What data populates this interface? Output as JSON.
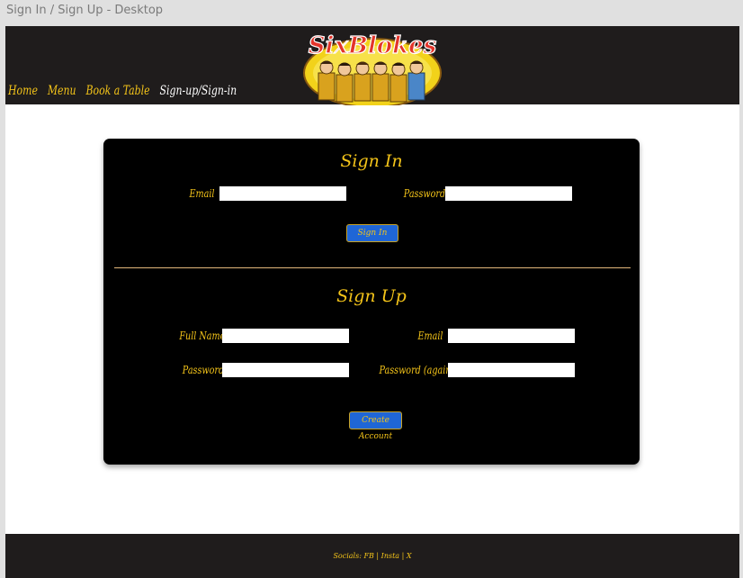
{
  "frame_title": "Sign In / Sign Up - Desktop",
  "nav": {
    "items": [
      {
        "label": "Home"
      },
      {
        "label": "Menu"
      },
      {
        "label": "Book a Table"
      },
      {
        "label": "Sign-up/Sign-in"
      }
    ],
    "active_index": 3
  },
  "logo": {
    "text": "SixBlokes"
  },
  "signin": {
    "title": "Sign In",
    "email_label": "Email",
    "email_value": "",
    "password_label": "Password",
    "password_value": "",
    "button_label": "Sign In"
  },
  "signup": {
    "title": "Sign Up",
    "fullname_label": "Full Name",
    "fullname_value": "",
    "email_label": "Email",
    "email_value": "",
    "password_label": "Password",
    "password_value": "",
    "password_again_label": "Password (again)",
    "password_again_value": "",
    "button_label": "Create Account"
  },
  "footer": {
    "text": "Socials: FB | Insta | X"
  },
  "colors": {
    "accent": "#f4c419",
    "header_bg": "#1f1c1c",
    "button_bg": "#1f66d6"
  }
}
